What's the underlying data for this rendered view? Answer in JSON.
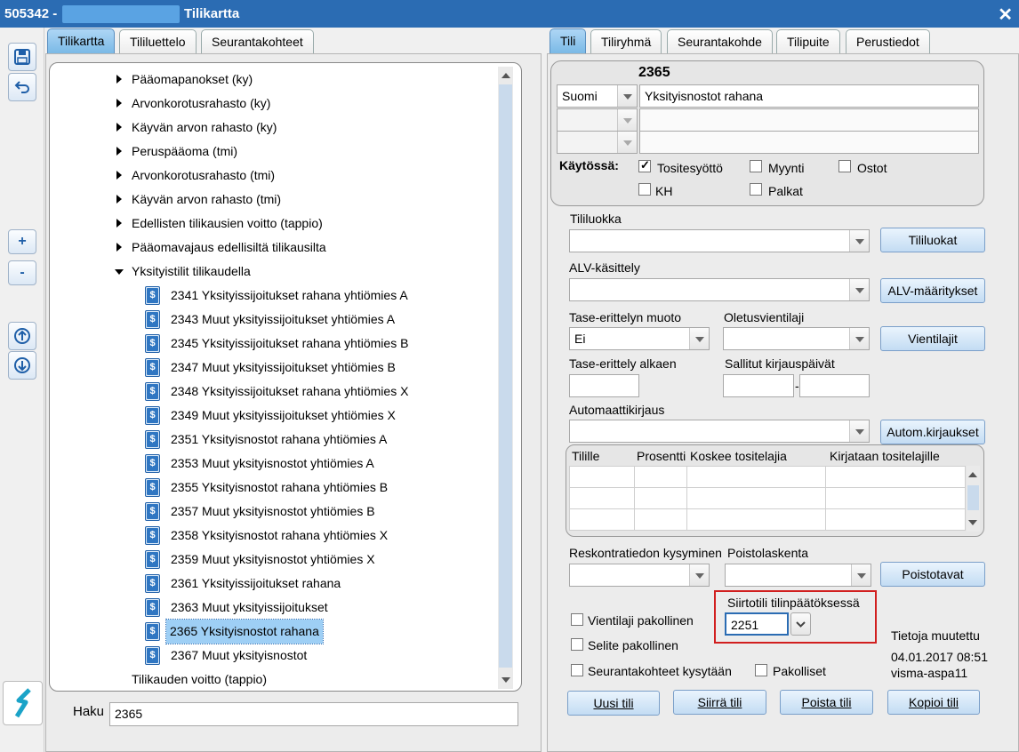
{
  "titlebar": {
    "number": "505342 -",
    "title": "Tilikartta",
    "close": "✕"
  },
  "left_tabs": [
    "Tilikartta",
    "Tililuettelo",
    "Seurantakohteet"
  ],
  "right_tabs": [
    "Tili",
    "Tiliryhmä",
    "Seurantakohde",
    "Tilipuite",
    "Perustiedot"
  ],
  "tree": {
    "groups": [
      "Pääomapanokset (ky)",
      "Arvonkorotusrahasto (ky)",
      "Käyvän arvon rahasto (ky)",
      "Peruspääoma (tmi)",
      "Arvonkorotusrahasto (tmi)",
      "Käyvän arvon rahasto (tmi)",
      "Edellisten tilikausien voitto (tappio)",
      "Pääomavajaus edellisiltä tilikausilta"
    ],
    "open_group": "Yksityistilit tilikaudella",
    "accounts": [
      "2341 Yksityissijoitukset rahana yhtiömies A",
      "2343 Muut yksityissijoitukset yhtiömies A",
      "2345 Yksityissijoitukset rahana yhtiömies B",
      "2347 Muut yksityissijoitukset  yhtiömies B",
      "2348 Yksityissijoitukset rahana yhtiömies X",
      "2349 Muut yksityissijoitukset yhtiömies X",
      "2351 Yksityisnostot rahana yhtiömies A",
      "2353 Muut yksityisnostot yhtiömies A",
      "2355 Yksityisnostot rahana yhtiömies B",
      "2357 Muut yksityisnostot  yhtiömies B",
      "2358 Yksityisnostot rahana yhtiömies X",
      "2359 Muut yksityisnostot yhtiömies X",
      "2361 Yksityissijoitukset rahana",
      "2363 Muut yksityissijoitukset",
      "2365 Yksityisnostot rahana",
      "2367 Muut yksityisnostot"
    ],
    "selected_index": 14,
    "last_item": "Tilikauden voitto (tappio)"
  },
  "search": {
    "label": "Haku",
    "value": "2365"
  },
  "account": {
    "number": "2365",
    "language": "Suomi",
    "name": "Yksityisnostot rahana",
    "in_use_label": "Käytössä:",
    "checks": {
      "tositesyotto": {
        "label": "Tositesyöttö",
        "checked": true
      },
      "myynti": {
        "label": "Myynti",
        "checked": false
      },
      "ostot": {
        "label": "Ostot",
        "checked": false
      },
      "kh": {
        "label": "KH",
        "checked": false
      },
      "palkat": {
        "label": "Palkat",
        "checked": false
      }
    }
  },
  "fields": {
    "tililuokka": "Tililuokka",
    "alv": "ALV-käsittely",
    "tase_muoto": "Tase-erittelyn muoto",
    "tase_muoto_value": "Ei",
    "oletusvientilaji": "Oletusvientilaji",
    "tase_alkaen": "Tase-erittely alkaen",
    "sallitut": "Sallitut kirjauspäivät",
    "sallitut_dash": "-",
    "automaatti": "Automaattikirjaus",
    "reskontra": "Reskontratiedon kysyminen",
    "poisto": "Poistolaskenta",
    "siirtotili": "Siirtotili tilinpäätöksessä",
    "siirtotili_value": "2251"
  },
  "side_buttons": {
    "tililuokat": "Tililuokat",
    "alv": "ALV-määritykset",
    "vientilajit": "Vientilajit",
    "autom": "Autom.kirjaukset",
    "poistotavat": "Poistotavat"
  },
  "auto_table": {
    "headers": [
      "Tilille",
      "Prosentti",
      "Koskee tositelajia",
      "Kirjataan tositelajille"
    ]
  },
  "bottom_checks": {
    "vientilaji": "Vientilaji pakollinen",
    "selite": "Selite pakollinen",
    "seuranta": "Seurantakohteet kysytään",
    "pakolliset": "Pakolliset"
  },
  "modified": {
    "label": "Tietoja muutettu",
    "date": "04.01.2017 08:51",
    "user": "visma-aspa11"
  },
  "actions": {
    "uusi": "Uusi tili",
    "siirra": "Siirrä tili",
    "poista": "Poista tili",
    "kopioi": "Kopioi tili"
  },
  "toolbar": {
    "plus": "+",
    "minus": "-"
  },
  "colors": {
    "titlebar": "#2b6cb3",
    "selection": "#9ecff5",
    "highlight_border": "#d11f1f"
  }
}
